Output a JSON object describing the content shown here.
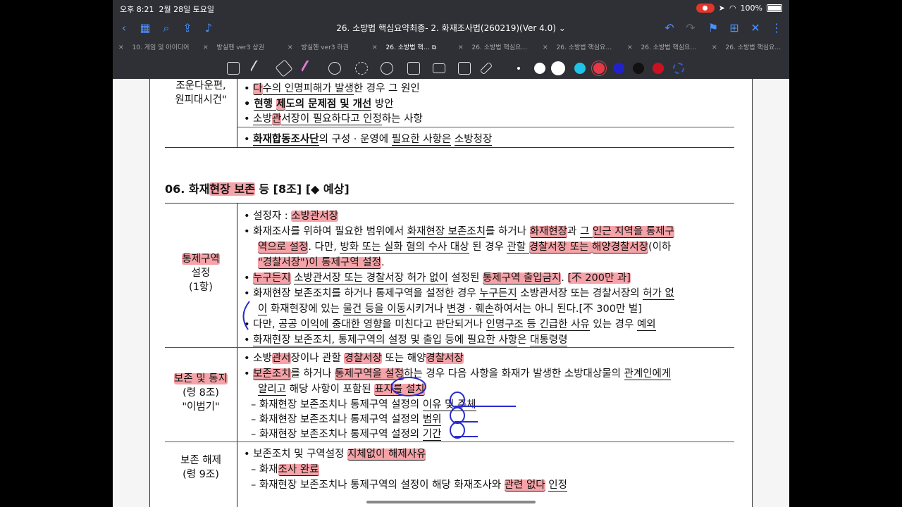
{
  "status": {
    "time": "오후 8:21",
    "date": "2월 28일 토요일",
    "battery": "100%"
  },
  "nav": {
    "title": "26. 소방법 핵심요약최종- 2. 화재조사법(260219)(Ver 4.0) ⌄"
  },
  "tabs": [
    {
      "label": "10. 게임 및 아이디어"
    },
    {
      "label": "방실헨 ver3 상권"
    },
    {
      "label": "방실헨 ver3 하권"
    },
    {
      "label": "26. 소방법 핵…"
    },
    {
      "label": "26. 소방법 핵심요…"
    },
    {
      "label": "26. 소방법 핵심요…"
    },
    {
      "label": "26. 소방법 핵심요…"
    },
    {
      "label": "26. 소방법 핵심요…"
    }
  ],
  "colors": {
    "highlight": "#f5a3a8",
    "toolbar_bg": "#2f3035",
    "accent": "#4a90ff",
    "pen_colors": [
      "#ffffff",
      "#ffffff",
      "#1fc3e6",
      "#e63946",
      "#2222cc",
      "#111111",
      "#cc1122",
      "#2b5fd6"
    ]
  },
  "doc": {
    "top_left_1": "조운다운편,",
    "top_left_2": "원피대시건\"",
    "top_lines": [
      [
        "• ",
        "다",
        "수의 인명피해가 발생",
        "한 경우 그 원인"
      ],
      [
        "• ",
        "현행 ",
        "제",
        "도의 문제점 및 개선",
        " 방안"
      ],
      [
        "• ",
        "소방",
        "관",
        "서장이 필요하다고 인정",
        "하는 사항"
      ]
    ],
    "top_line4": [
      "• ",
      "화재합동조사단",
      "의 구성 · 운영에 ",
      "필요한 사항은",
      " ",
      "소방청장"
    ],
    "section_title": [
      "06. 화재",
      "현장 보존",
      " 등 [8조] [◆ 예상]"
    ],
    "block1_label": [
      "통제구역",
      "설정",
      "(1항)"
    ],
    "block1": {
      "l1": [
        "• 설정자 : ",
        "소방관서장"
      ],
      "l2": [
        "• 화재조사를 위하여 필요한 범위에서 ",
        "화재현장 보존조치",
        "를 하거나 ",
        "화재현장",
        "과 ",
        "그 ",
        "인근 지역을 통제구"
      ],
      "l3": [
        "역으로 설정",
        ". 다만, ",
        "방화 또는 실화 혐의 수사 대상",
        " 된 경우 ",
        "관할 ",
        "경찰서장 또는 ",
        "해양경찰서장",
        "(이하"
      ],
      "l4": [
        "\"경찰서장\")이 통제구역 설정",
        "."
      ],
      "l5": [
        "• ",
        "누구든지",
        " ",
        "소방관서장 또는 경찰서장 허가 없이",
        " 설정된 ",
        "통제구역 출입금지",
        ". ",
        "[不 200만 과]"
      ],
      "l6": [
        "• 화재현장 보존조치를 하거나 통제구역을 설정한 경우 ",
        "누구든지",
        " 소방관서장 또는 경찰서장의 ",
        "허가 없"
      ],
      "l7": [
        "이",
        " 화재현장에 있는 ",
        "물건 등을 이동",
        "시키거나 ",
        "변경 · 훼손",
        "하여서는 아니 된다.[不 300만 벌]"
      ],
      "l8": [
        "• 다만, ",
        "공공 이익에 중대한 영향",
        "을 미친다고 판단되거나 ",
        "인명구조 등 긴급한 사유",
        " 있는 경우 ",
        "예외"
      ],
      "l9": [
        "• ",
        "화재현장 보존조치, 통제구역의 설정 및 출입 등에 필요한 사항",
        "은 ",
        "대통령령"
      ]
    },
    "block2_label": [
      "보존 및 통지",
      "(령 8조)",
      "\"이범기\""
    ],
    "block2": {
      "l1": [
        "• 소방",
        "관서",
        "장이나 관할 ",
        "경찰서장",
        " 또는 해양",
        "경찰서장"
      ],
      "l2": [
        "• ",
        "보존조치",
        "를 하거나 ",
        "통제구역을 설정",
        "하는 경우 다음 사항을 화재가 발생한 소방대상물의 ",
        "관계인에게"
      ],
      "l3": [
        "알리고",
        " 해당 사항이 포함된 ",
        "표지를 설치"
      ],
      "l4": [
        "– 화재현장 보존조치나 통제구역 설정의 ",
        "이유 및 주체"
      ],
      "l5": [
        "– 화재현장 보존조치나 통제구역 설정의 ",
        "범위"
      ],
      "l6": [
        "– 화재현장 보존조치나 통제구역 설정의 ",
        "기간"
      ]
    },
    "block3_label": [
      "보존 해제",
      "(령 9조)"
    ],
    "block3": {
      "l1": [
        "• 보존조치 및 구역설정 ",
        "지체없이 해제사유"
      ],
      "l2": [
        "– 화재",
        "조사 완료"
      ],
      "l3": [
        "– 화재현장 보존조치나 통제구역의 설정이 해당 화재조사와 ",
        "관련 없다",
        " ",
        "인정"
      ]
    }
  }
}
